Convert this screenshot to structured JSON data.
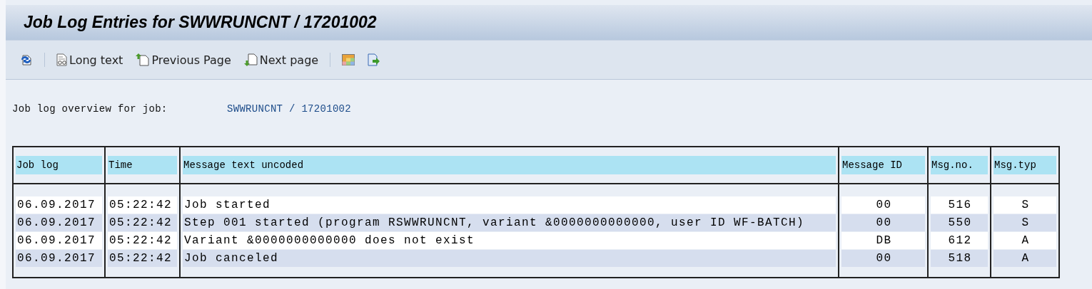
{
  "window": {
    "title": "Job Log Entries for SWWRUNCNT / 17201002"
  },
  "toolbar": [
    {
      "kind": "refresh"
    },
    {
      "kind": "separator"
    },
    {
      "kind": "longtext",
      "label": "Long text"
    },
    {
      "kind": "prev",
      "label": "Previous Page"
    },
    {
      "kind": "next",
      "label": "Next page"
    },
    {
      "kind": "separator"
    },
    {
      "kind": "grid"
    },
    {
      "kind": "export"
    }
  ],
  "overview": {
    "label": "Job log overview for job:",
    "value": "SWWRUNCNT / 17201002"
  },
  "table": {
    "columns": [
      {
        "label": "Job log"
      },
      {
        "label": "Time"
      },
      {
        "label": "Message text uncoded"
      },
      {
        "label": "Message ID"
      },
      {
        "label": "Msg.no."
      },
      {
        "label": "Msg.typ"
      }
    ],
    "rows": [
      [
        "06.09.2017",
        "05:22:42",
        "Job started",
        "00",
        "516",
        "S"
      ],
      [
        "06.09.2017",
        "05:22:42",
        "Step 001 started (program RSWWRUNCNT, variant &0000000000000, user ID WF-BATCH)",
        "00",
        "550",
        "S"
      ],
      [
        "06.09.2017",
        "05:22:42",
        "Variant &0000000000000 does not exist",
        "DB",
        "612",
        "A"
      ],
      [
        "06.09.2017",
        "05:22:42",
        "Job canceled",
        "00",
        "518",
        "A"
      ]
    ]
  }
}
